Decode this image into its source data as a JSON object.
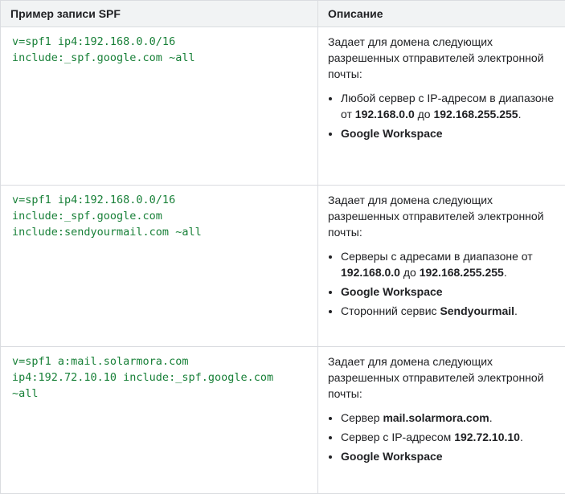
{
  "table": {
    "headers": [
      "Пример записи SPF",
      "Описание"
    ],
    "rows": [
      {
        "code": [
          "v=spf1 ip4:192.168.0.0/16",
          "include:_spf.google.com ~all"
        ],
        "intro": "Задает для домена следующих разрешенных отправителей электронной почты:",
        "items": [
          {
            "text_before": "Любой сервер с IP-адресом в диапазоне от ",
            "bold1": "192.168.0.0",
            "text_middle": " до ",
            "bold2": "192.168.255.255",
            "text_after": "."
          },
          {
            "bold": "Google Workspace"
          }
        ]
      },
      {
        "code": [
          "v=spf1 ip4:192.168.0.0/16",
          "include:_spf.google.com",
          "include:sendyourmail.com ~all"
        ],
        "intro": "Задает для домена следующих разрешенных отправителей электронной почты:",
        "items": [
          {
            "text_before": "Серверы с адресами в диапазоне от ",
            "bold1": "192.168.0.0",
            "text_middle": " до ",
            "bold2": "192.168.255.255",
            "text_after": "."
          },
          {
            "bold": "Google Workspace"
          },
          {
            "text_before": "Сторонний сервис ",
            "bold1": "Sendyourmail",
            "text_after": "."
          }
        ]
      },
      {
        "code": [
          "v=spf1 a:mail.solarmora.com",
          "ip4:192.72.10.10 include:_spf.google.com",
          "~all"
        ],
        "intro": "Задает для домена следующих разрешенных отправителей электронной почты:",
        "items": [
          {
            "text_before": "Сервер ",
            "bold1": "mail.solarmora.com",
            "text_after": "."
          },
          {
            "text_before": "Сервер с IP-адресом ",
            "bold1": "192.72.10.10",
            "text_after": "."
          },
          {
            "bold": "Google Workspace"
          }
        ]
      }
    ]
  }
}
